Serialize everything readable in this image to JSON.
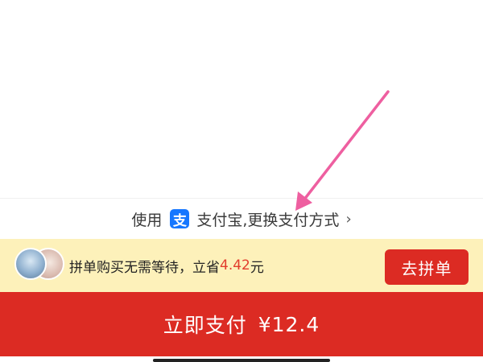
{
  "payment_method": {
    "prefix": "使用",
    "icon": "alipay-icon",
    "icon_glyph": "支",
    "name": "支付宝,",
    "change_label": "更换支付方式",
    "chevron": "›",
    "icon_color": "#1677ff"
  },
  "group_buy": {
    "text_before": "拼单购买无需等待，立省",
    "saving": "4.42",
    "unit": "元",
    "join_button": "去拼单"
  },
  "pay_button": {
    "label": "立即支付",
    "amount": "¥12.4"
  },
  "colors": {
    "primary_red": "#dc2b23",
    "highlight_bg": "#fdf1ba",
    "annotation_arrow": "#ee5fa0"
  }
}
